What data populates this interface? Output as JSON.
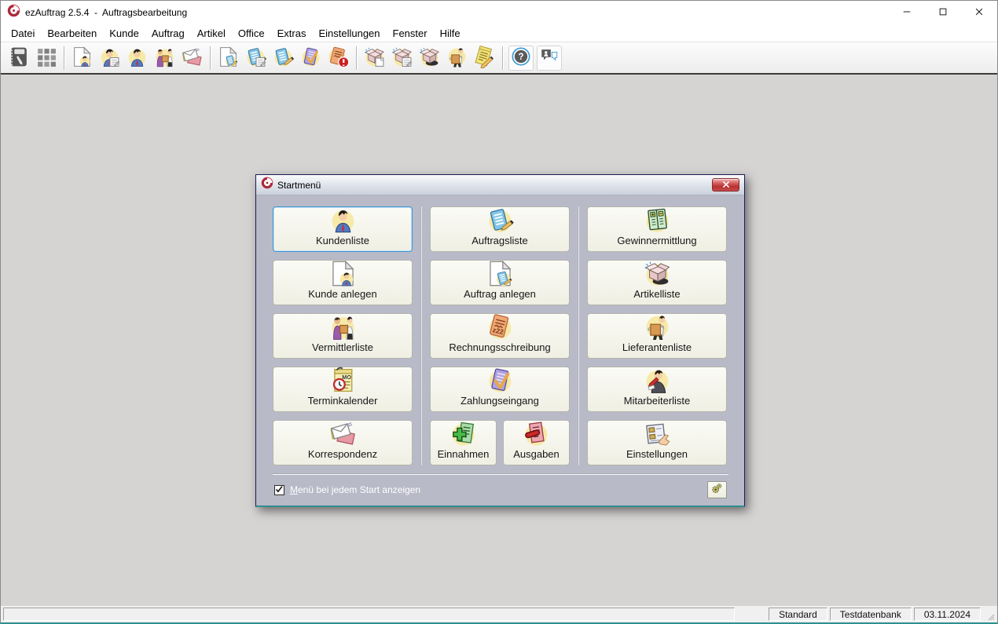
{
  "window": {
    "title": "ezAuftrag 2.5.4  -  Auftragsbearbeitung",
    "app_icon": "ezauftrag-logo-icon",
    "control_icons": [
      "minimize-icon",
      "maximize-icon",
      "close-icon"
    ]
  },
  "menubar": {
    "items": [
      "Datei",
      "Bearbeiten",
      "Kunde",
      "Auftrag",
      "Artikel",
      "Office",
      "Extras",
      "Einstellungen",
      "Fenster",
      "Hilfe"
    ]
  },
  "toolbar": {
    "groups": [
      [
        "address-book",
        "grid"
      ],
      [
        "new-customer",
        "customer-form",
        "customer",
        "broker",
        "correspondence"
      ],
      [
        "new-order",
        "order-form",
        "order-list",
        "payment-check",
        "overdue-invoice"
      ],
      [
        "new-article",
        "article-form",
        "article-list",
        "supplier",
        "notepad"
      ],
      [
        "help",
        "feedback"
      ]
    ],
    "boxed_icons": [
      "help",
      "feedback"
    ]
  },
  "startmenu": {
    "title": "Startmenü",
    "title_icon": "ezauftrag-logo-icon",
    "close_icon": "close-icon",
    "columns": [
      {
        "buttons": [
          {
            "label": "Kundenliste",
            "icon": "customer",
            "focused": true
          },
          {
            "label": "Kunde anlegen",
            "icon": "new-customer"
          },
          {
            "label": "Vermittlerliste",
            "icon": "broker"
          },
          {
            "label": "Terminkalender",
            "icon": "calendar"
          },
          {
            "label": "Korrespondenz",
            "icon": "correspondence"
          }
        ]
      },
      {
        "buttons": [
          {
            "label": "Auftragsliste",
            "icon": "order-list"
          },
          {
            "label": "Auftrag anlegen",
            "icon": "new-order"
          },
          {
            "label": "Rechnungsschreibung",
            "icon": "invoice"
          },
          {
            "label": "Zahlungseingang",
            "icon": "payment-check"
          },
          {
            "split": [
              {
                "label": "Einnahmen",
                "icon": "income"
              },
              {
                "label": "Ausgaben",
                "icon": "expense"
              }
            ]
          }
        ]
      },
      {
        "buttons": [
          {
            "label": "Gewinnermittlung",
            "icon": "profit"
          },
          {
            "label": "Artikelliste",
            "icon": "article-list"
          },
          {
            "label": "Lieferantenliste",
            "icon": "supplier"
          },
          {
            "label": "Mitarbeiterliste",
            "icon": "employee"
          },
          {
            "label": "Einstellungen",
            "icon": "settings"
          }
        ]
      }
    ],
    "checkbox": {
      "label": "Menü bei jedem Start anzeigen",
      "checked": true
    },
    "gear_button_icon": "gears-icon"
  },
  "statusbar": {
    "panels": [
      {
        "id": "profile",
        "text": "Standard"
      },
      {
        "id": "database",
        "text": "Testdatenbank"
      },
      {
        "id": "date",
        "text": "03.11.2024"
      }
    ]
  },
  "colors": {
    "dialog_body": "#b9bac8",
    "button_bg": "#f5f5ec",
    "button_border": "#b4b4aa",
    "focus_border": "#3d96d2",
    "close_red": "#c03535",
    "icon_halo": "#f7e9a8",
    "client_bg": "#d6d3d3",
    "teal_edge": "#2f8f8f"
  }
}
